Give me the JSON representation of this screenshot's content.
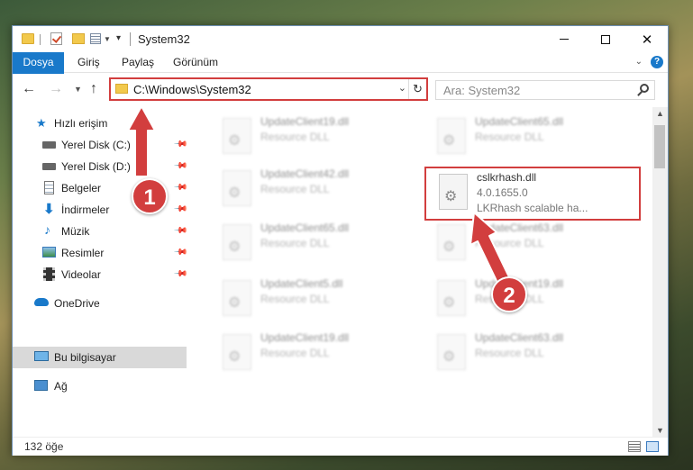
{
  "window": {
    "title": "System32",
    "caption_min": "",
    "caption_close": "✕"
  },
  "ribbon": {
    "tabs": [
      "Dosya",
      "Giriş",
      "Paylaş",
      "Görünüm"
    ],
    "chevron": "⌄",
    "help": "?"
  },
  "address": {
    "path": "C:\\Windows\\System32",
    "dropdown": "⌄",
    "refresh": "↻"
  },
  "search": {
    "placeholder": "Ara: System32"
  },
  "sidebar": {
    "items": [
      {
        "label": "Hızlı erişim",
        "icon": "star-icon"
      },
      {
        "label": "Yerel Disk (C:)",
        "icon": "drive-icon"
      },
      {
        "label": "Yerel Disk (D:)",
        "icon": "drive-icon"
      },
      {
        "label": "Belgeler",
        "icon": "documents-icon"
      },
      {
        "label": "İndirmeler",
        "icon": "download-icon"
      },
      {
        "label": "Müzik",
        "icon": "music-icon"
      },
      {
        "label": "Resimler",
        "icon": "pictures-icon"
      },
      {
        "label": "Videolar",
        "icon": "videos-icon"
      },
      {
        "label": "OneDrive",
        "icon": "cloud-icon"
      },
      {
        "label": "Bu bilgisayar",
        "icon": "computer-icon"
      },
      {
        "label": "Ağ",
        "icon": "network-icon"
      }
    ]
  },
  "files": [
    {
      "name": "UpdateClient19.dll",
      "desc": "Resource DLL"
    },
    {
      "name": "UpdateClient65.dll",
      "desc": "Resource DLL"
    },
    {
      "name": "UpdateClient42.dll",
      "desc": "Resource DLL"
    },
    {
      "name": "UpdateClient65.dll",
      "desc": "Resource DLL"
    },
    {
      "name": "UpdateClient63.dll",
      "desc": "Resource DLL"
    },
    {
      "name": "UpdateClient5.dll",
      "desc": "Resource DLL"
    },
    {
      "name": "UpdateClient19.dll",
      "desc": "Resource DLL"
    },
    {
      "name": "UpdateClient19.dll",
      "desc": "Resource DLL"
    },
    {
      "name": "UpdateClient63.dll",
      "desc": "Resource DLL"
    }
  ],
  "highlighted_file": {
    "name": "cslkrhash.dll",
    "version": "4.0.1655.0",
    "desc": "LKRhash scalable ha..."
  },
  "status": {
    "count": "132 öğe"
  },
  "annotations": {
    "step1": "1",
    "step2": "2"
  },
  "colors": {
    "accent": "#1979ca",
    "highlight_border": "#d23e3e"
  }
}
